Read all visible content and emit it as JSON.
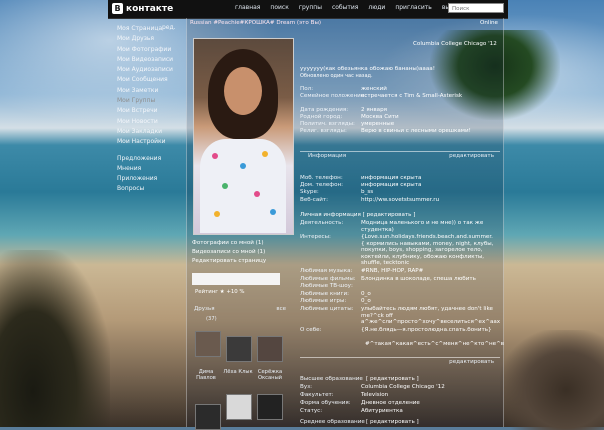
{
  "header": {
    "logo": "контакте",
    "logo_badge": "В",
    "nav": [
      "главная",
      "поиск",
      "группы",
      "события",
      "люди",
      "пригласить",
      "выйти"
    ],
    "search_placeholder": "Поиск"
  },
  "sidebar": {
    "edit_label": "ред.",
    "items": [
      "Моя Страница",
      "Мои Друзья",
      "Мои Фотографии",
      "Мои Видеозаписи",
      "Мои Аудиозаписи",
      "Мои Сообщения",
      "Мои Заметки",
      "Мои Группы",
      "Мои Встречи",
      "Мои Новости",
      "Мои Закладки",
      "Мои Настройки"
    ],
    "extra": [
      "Предложения",
      "Мнения",
      "Приложения",
      "Вопросы"
    ]
  },
  "profile": {
    "name_line": "Russian #Peachie#КРОШКА# Dream (это Вы)",
    "online": "Online",
    "college": "Columbia College Chicago '12",
    "status_text": "ууууууу(как обезьянка обожаю бананы)аааа!",
    "status_updated": "Обновлено один час назад.",
    "basic": [
      {
        "label": "Пол:",
        "value": "женский"
      },
      {
        "label": "Семейное положение:",
        "value": "встречается с Tim & Small-Asterisk"
      },
      {
        "label": "Дата рождения:",
        "value": "2 января"
      },
      {
        "label": "Родной город:",
        "value": "Москва Сити"
      },
      {
        "label": "Политич. взгляды:",
        "value": "умеренные"
      },
      {
        "label": "Религ. взгляды:",
        "value": "Верю в свиньи с лесными орешками!"
      }
    ],
    "info_header": "Информация",
    "info_edit": "редактировать",
    "contact": [
      {
        "label": "Моб. телефон:",
        "value": "информация скрыта"
      },
      {
        "label": "Дом. телефон:",
        "value": "информация скрыта"
      },
      {
        "label": "Skype:",
        "value": "b_ss"
      },
      {
        "label": "Веб-сайт:",
        "value": "http://ww.sovetstsummer.ru"
      }
    ],
    "personal_header": "Личная информация [ редактировать ]",
    "personal": [
      {
        "label": "Деятельность:",
        "value": "Модница маленького и не мне)) о так же студентка)"
      },
      {
        "label": "Интересы:",
        "value": "{Love.sun.holidays.friends.beach.and.summer.{ кормились навыками, money, night, клубы, покупки, boys, shopping, загорелое тело, коктейли, клубнику, обожаю конфликты, shuffle, tecktonic"
      },
      {
        "label": "Любимая музыка:",
        "value": "#RNB, HIP-HOP, RAP#"
      },
      {
        "label": "Любимые фильмы:",
        "value": "Блондинка в шоколаде, спеша любить"
      },
      {
        "label": "Любимые ТВ-шоу:",
        "value": ""
      },
      {
        "label": "Любимые книги:",
        "value": "0_o"
      },
      {
        "label": "Любимые игры:",
        "value": "0_o"
      },
      {
        "label": "Любимые цитаты:",
        "value": "улыбайтесь людям любят, удачнее don't like me?^ck off а^же^сли^просто^хочу^веселиться^ех^аах"
      },
      {
        "label": "О себе:",
        "value": "{Я.не.блядь—я.простолюдна.спать.бонить}"
      },
      {
        "label": "",
        "value": "#^такая^какая^есть^с^меня^не^кто^не^в"
      }
    ],
    "edu_edit": "редактировать",
    "education": [
      {
        "label": "Высшее образование",
        "value": "[ редактировать ]"
      },
      {
        "label": "Вуз:",
        "value": "Columbia College Chicago '12"
      },
      {
        "label": "Факультет:",
        "value": "Television"
      },
      {
        "label": "Форма обучения:",
        "value": "Дневное отделение"
      },
      {
        "label": "Статус:",
        "value": "Абитуриентка"
      },
      {
        "label": "Среднее образование",
        "value": "[ редактировать ]"
      }
    ]
  },
  "left_col": {
    "photo_links": [
      "Фотографии со мной (1)",
      "Видеозаписи со мной (1)",
      "Редактировать страницу"
    ],
    "rating": "Рейтинг ★ +10 %",
    "friends_title": "Друзья",
    "friends_all": "все",
    "friends_count": "(37)",
    "friends": [
      "Дима Павлов",
      "Лёха Клык",
      "Серёжка Оксаный"
    ]
  }
}
